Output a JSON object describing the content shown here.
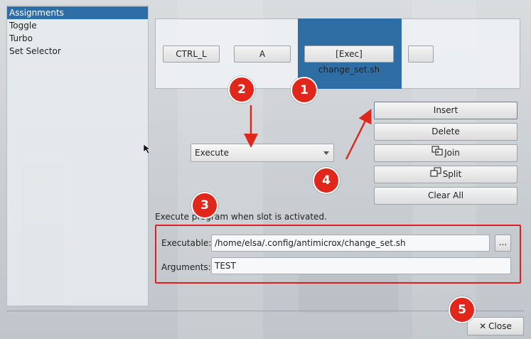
{
  "sidebar": {
    "items": [
      {
        "label": "Assignments",
        "selected": true
      },
      {
        "label": "Toggle",
        "selected": false
      },
      {
        "label": "Turbo",
        "selected": false
      },
      {
        "label": "Set Selector",
        "selected": false
      }
    ]
  },
  "slots": {
    "items": [
      "CTRL_L",
      "A",
      "[Exec] change_set.sh",
      ""
    ],
    "selected_index": 2
  },
  "actions": {
    "insert": "Insert",
    "delete": "Delete",
    "join": "Join",
    "split": "Split",
    "clear_all": "Clear All"
  },
  "mode_select": {
    "value": "Execute"
  },
  "description": "Execute program when slot is activated.",
  "exec": {
    "executable_label": "Executable:",
    "executable_value": "/home/elsa/.config/antimicrox/change_set.sh",
    "browse_label": "...",
    "arguments_label": "Arguments:",
    "arguments_value": "TEST"
  },
  "footer": {
    "close_label": "Close"
  },
  "annotations": {
    "badges": [
      "1",
      "2",
      "3",
      "4",
      "5"
    ],
    "color": "#e1261c"
  },
  "colors": {
    "accent": "#2f6ea5",
    "highlight_frame": "#e02020"
  }
}
